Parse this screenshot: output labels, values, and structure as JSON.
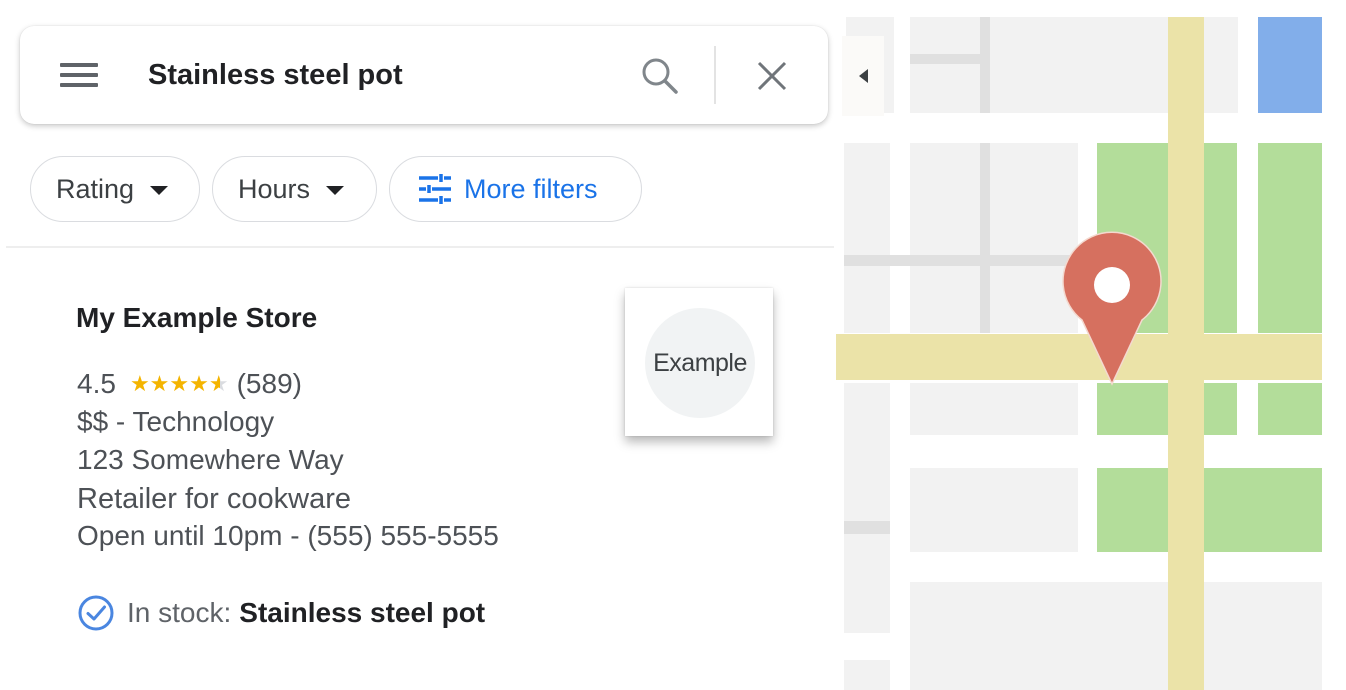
{
  "search": {
    "query": "Stainless steel pot",
    "menu_icon": "hamburger-menu-icon",
    "search_icon": "search-icon",
    "clear_icon": "close-icon"
  },
  "filters": [
    {
      "label": "Rating",
      "icon": "caret-down-icon"
    },
    {
      "label": "Hours",
      "icon": "caret-down-icon"
    },
    {
      "label": "More filters",
      "icon": "tune-icon"
    }
  ],
  "result": {
    "name": "My Example Store",
    "rating": "4.5",
    "rating_value": 4.5,
    "rating_max": 5,
    "review_count": "(589)",
    "price_category": "$$ - Technology",
    "address": "123 Somewhere Way",
    "description": "Retailer for cookware",
    "hours_phone": "Open until 10pm - (555) 555-5555",
    "stock_label": "In stock:",
    "stock_product": "Stainless steel pot",
    "thumbnail_text": "Example"
  },
  "map": {
    "collapse_icon": "collapse-left-icon",
    "marker_icon": "map-pin-icon",
    "colors": {
      "block": "#f2f2f2",
      "minor_road": "#e0e0e0",
      "major_road": "#ebe3a8",
      "park": "#b3dd9a",
      "water": "#82aeea",
      "marker": "#d6705f"
    }
  },
  "colors": {
    "accent": "#1a73e8",
    "star": "#f4b400",
    "text_primary": "#202124",
    "text_secondary": "#4d5156"
  }
}
